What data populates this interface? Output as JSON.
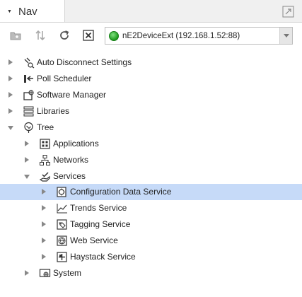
{
  "tab": {
    "title": "Nav"
  },
  "toolbar": {
    "station": "nE2DeviceExt (192.168.1.52:88)"
  },
  "tree": [
    {
      "label": "Auto Disconnect Settings",
      "icon": "auto-disconnect-icon",
      "expanded": false
    },
    {
      "label": "Poll Scheduler",
      "icon": "poll-scheduler-icon",
      "expanded": false
    },
    {
      "label": "Software Manager",
      "icon": "software-manager-icon",
      "expanded": false
    },
    {
      "label": "Libraries",
      "icon": "libraries-icon",
      "expanded": false
    },
    {
      "label": "Tree",
      "icon": "tree-icon",
      "expanded": true
    },
    {
      "label": "Applications",
      "icon": "applications-icon",
      "expanded": false
    },
    {
      "label": "Networks",
      "icon": "networks-icon",
      "expanded": false
    },
    {
      "label": "Services",
      "icon": "services-icon",
      "expanded": true
    },
    {
      "label": "Configuration Data Service",
      "icon": "configuration-data-icon",
      "expanded": false,
      "selected": true
    },
    {
      "label": "Trends Service",
      "icon": "trends-icon",
      "expanded": false
    },
    {
      "label": "Tagging Service",
      "icon": "tagging-icon",
      "expanded": false
    },
    {
      "label": "Web Service",
      "icon": "web-service-icon",
      "expanded": false
    },
    {
      "label": "Haystack Service",
      "icon": "haystack-icon",
      "expanded": false
    },
    {
      "label": "System",
      "icon": "system-icon",
      "expanded": false
    }
  ],
  "colors": {
    "selection": "#c6daf8",
    "status_online": "#1c9a1c"
  }
}
